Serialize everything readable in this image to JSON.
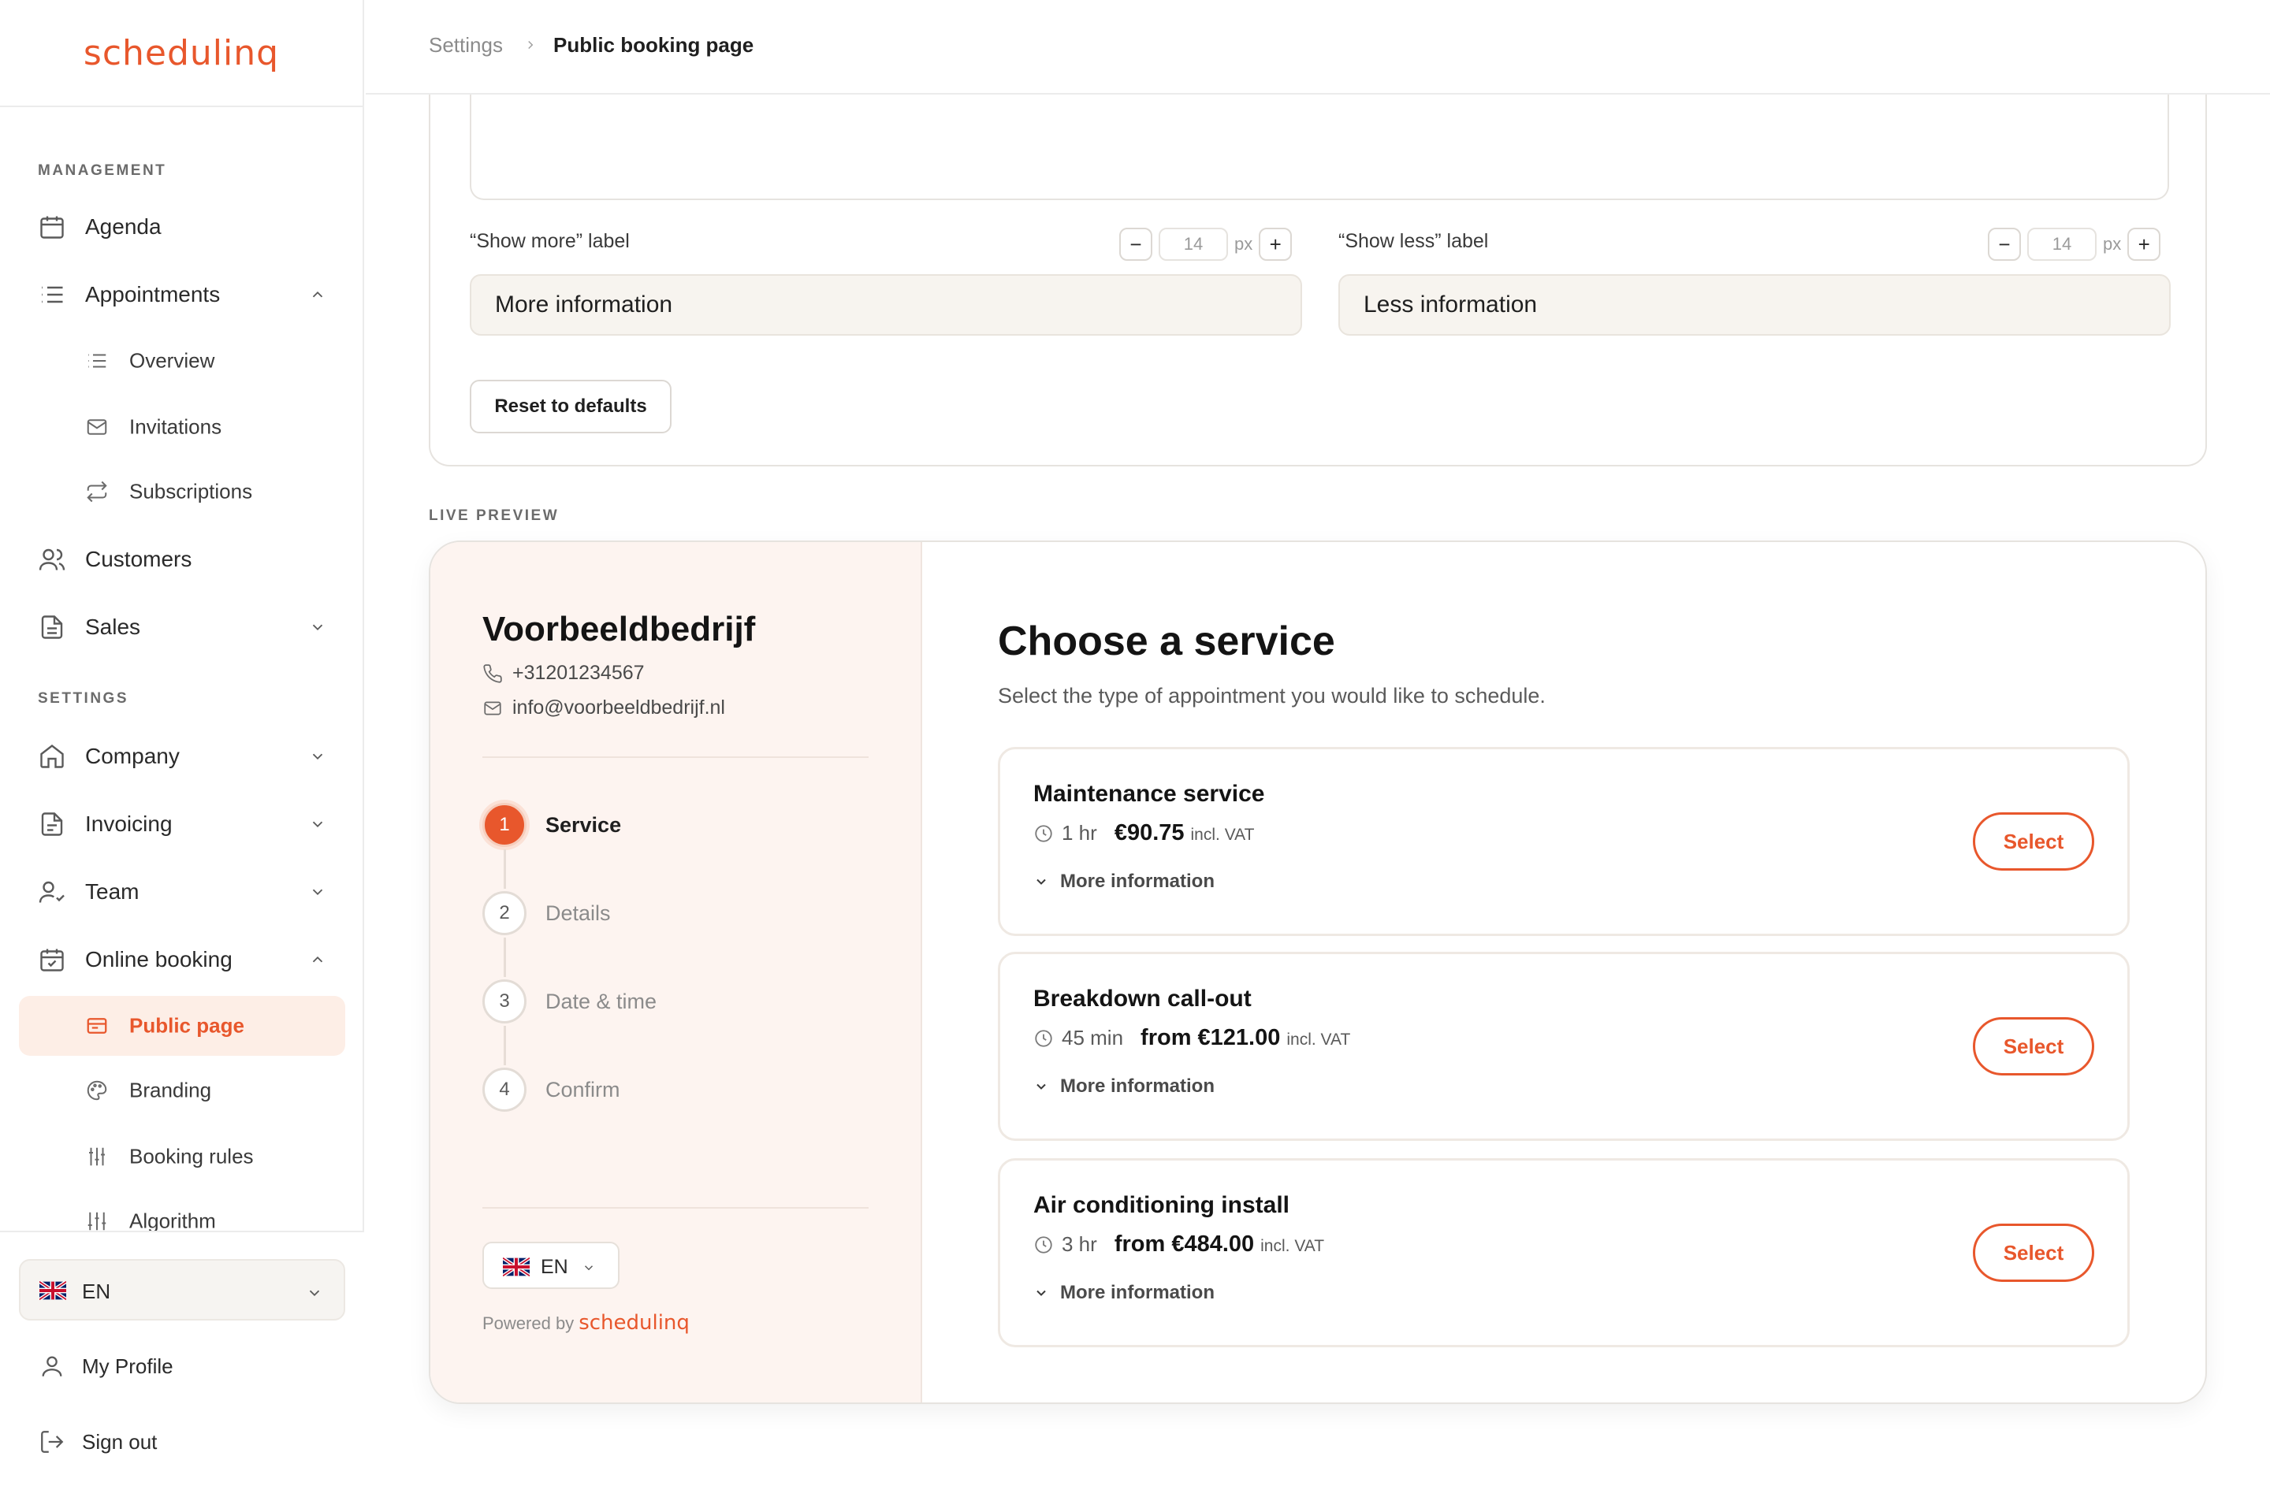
{
  "brand": {
    "logo_text": "schedulinq",
    "accent": "#e8572c"
  },
  "sidebar": {
    "management_label": "MANAGEMENT",
    "settings_label": "SETTINGS",
    "items": {
      "agenda": "Agenda",
      "appointments": "Appointments",
      "overview": "Overview",
      "invitations": "Invitations",
      "subscriptions": "Subscriptions",
      "customers": "Customers",
      "sales": "Sales",
      "company": "Company",
      "invoicing": "Invoicing",
      "team": "Team",
      "online_booking": "Online booking",
      "public_page": "Public page",
      "branding": "Branding",
      "booking_rules": "Booking rules",
      "algorithm": "Algorithm"
    },
    "language": "EN",
    "my_profile": "My Profile",
    "sign_out": "Sign out"
  },
  "header": {
    "breadcrumb": [
      "Settings",
      "Public booking page"
    ]
  },
  "settings": {
    "show_more_label": "“Show more” label",
    "show_less_label": "“Show less” label",
    "show_more_size": "14",
    "show_less_size": "14",
    "unit": "px",
    "minus": "−",
    "plus": "+",
    "show_more_value": "More information",
    "show_less_value": "Less information",
    "reset_button": "Reset to defaults"
  },
  "live_preview_label": "LIVE PREVIEW",
  "preview": {
    "company_name": "Voorbeeldbedrijf",
    "phone": "+31201234567",
    "email": "info@voorbeeldbedrijf.nl",
    "steps": [
      {
        "num": "1",
        "label": "Service"
      },
      {
        "num": "2",
        "label": "Details"
      },
      {
        "num": "3",
        "label": "Date & time"
      },
      {
        "num": "4",
        "label": "Confirm"
      }
    ],
    "language": "EN",
    "powered_by": "Powered by",
    "title": "Choose a service",
    "subtitle": "Select the type of appointment you would like to schedule.",
    "services": [
      {
        "name": "Maintenance service",
        "duration": "1 hr",
        "price": "€90.75",
        "vat": "incl. VAT",
        "more": "More information",
        "select": "Select"
      },
      {
        "name": "Breakdown call-out",
        "duration": "45 min",
        "price": "from €121.00",
        "vat": "incl. VAT",
        "more": "More information",
        "select": "Select"
      },
      {
        "name": "Air conditioning install",
        "duration": "3 hr",
        "price": "from €484.00",
        "vat": "incl. VAT",
        "more": "More information",
        "select": "Select"
      }
    ]
  }
}
